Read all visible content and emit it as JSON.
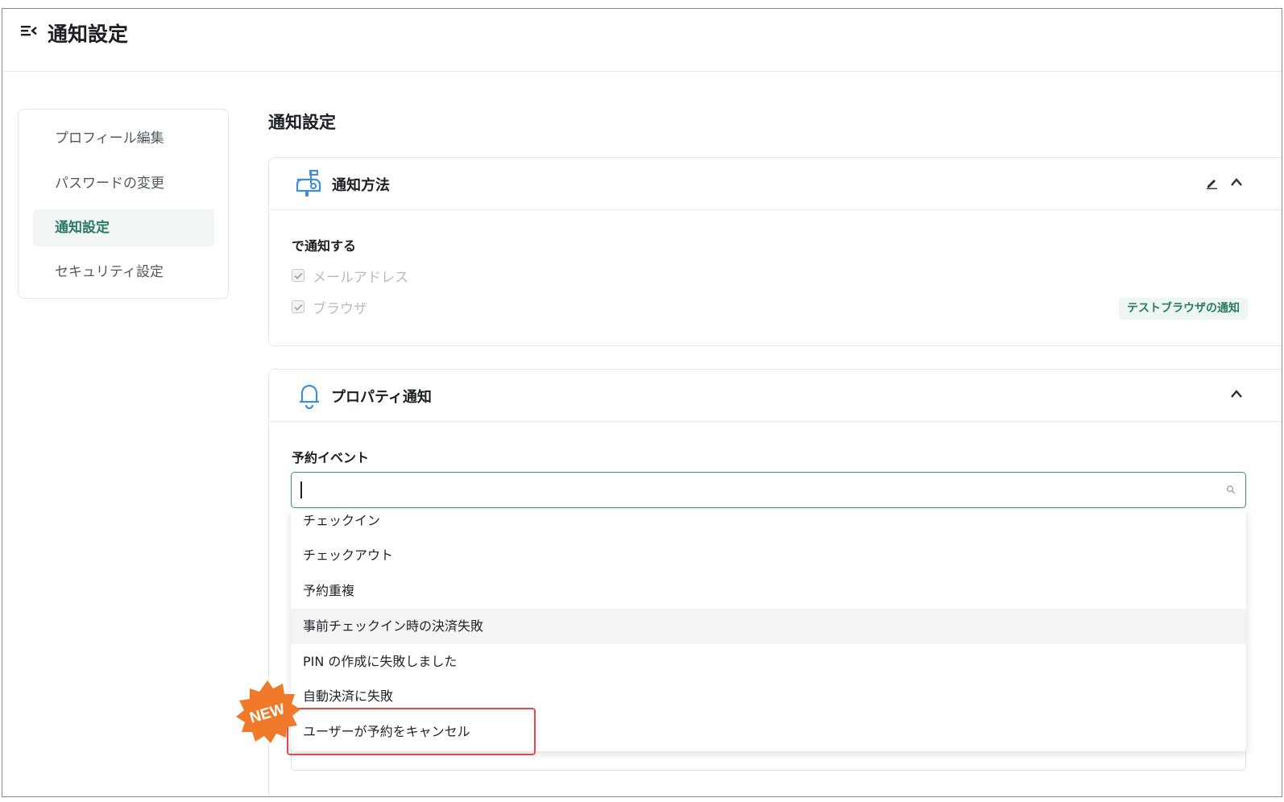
{
  "header": {
    "title": "通知設定",
    "menu_icon": "menu-collapse-icon"
  },
  "sidebar": {
    "items": [
      {
        "label": "プロフィール編集",
        "active": false
      },
      {
        "label": "パスワードの変更",
        "active": false
      },
      {
        "label": "通知設定",
        "active": true
      },
      {
        "label": "セキュリティ設定",
        "active": false
      }
    ]
  },
  "main": {
    "section_title": "通知設定",
    "notify_method": {
      "title": "通知方法",
      "icon": "mailbox-icon",
      "field_label": "で通知する",
      "options": [
        {
          "label": "メールアドレス",
          "checked": true,
          "disabled": true
        },
        {
          "label": "ブラウザ",
          "checked": true,
          "disabled": true
        }
      ],
      "test_button": "テストブラウザの通知"
    },
    "property_notify": {
      "title": "プロパティ通知",
      "icon": "bell-icon",
      "field_label": "予約イベント",
      "search": {
        "value": "",
        "placeholder": ""
      },
      "dropdown_options": [
        "チェックイン",
        "チェックアウト",
        "予約重複",
        "事前チェックイン時の決済失敗",
        "PIN の作成に失敗しました",
        "自動決済に失敗",
        "ユーザーが予約をキャンセル"
      ],
      "hovered_option_index": 3,
      "highlighted_option_index": 6,
      "badge": "NEW"
    }
  },
  "colors": {
    "accent": "#2b7a66",
    "active_bg": "#f1f6f5",
    "icon_blue": "#3f8fd8",
    "highlight_red": "#e5484d",
    "badge_orange": "#f07a2a"
  }
}
